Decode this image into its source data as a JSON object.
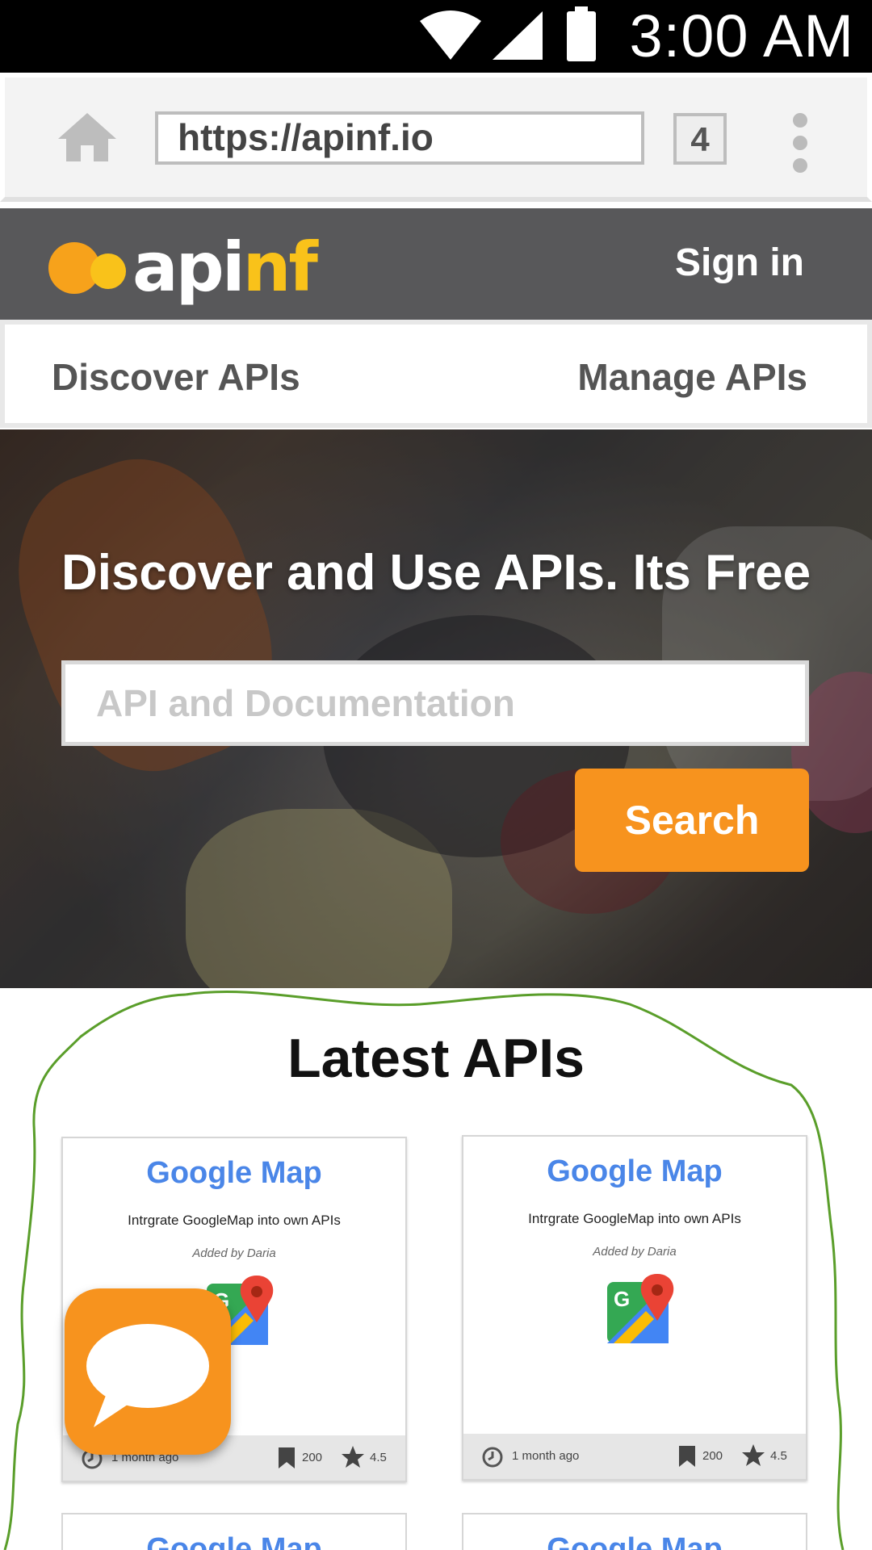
{
  "status_bar": {
    "time": "3:00 AM",
    "icons": [
      "wifi-icon",
      "cell-signal-icon",
      "battery-icon"
    ]
  },
  "browser": {
    "url": "https://apinf.io",
    "tab_count": "4",
    "icons": [
      "home-icon",
      "overflow-menu-icon"
    ]
  },
  "header": {
    "logo_text_main": "api",
    "logo_text_accent": "nf",
    "sign_in": "Sign in"
  },
  "nav": {
    "discover": "Discover APIs",
    "manage": "Manage APIs"
  },
  "hero": {
    "title": "Discover and Use APIs. Its Free",
    "search_placeholder": "API and Documentation",
    "search_button": "Search"
  },
  "latest": {
    "title": "Latest APIs",
    "cards": [
      {
        "name": "Google Map",
        "description": "Intrgrate GoogleMap into own APIs",
        "author": "Added by Daria",
        "age": "1 month ago",
        "bookmarks": "200",
        "rating": "4.5"
      },
      {
        "name": "Google Map",
        "description": "Intrgrate GoogleMap into own APIs",
        "author": "Added by Daria",
        "age": "1 month ago",
        "bookmarks": "200",
        "rating": "4.5"
      },
      {
        "name": "Google Map"
      },
      {
        "name": "Google Map"
      }
    ]
  },
  "colors": {
    "accent_orange": "#f7931e",
    "header_gray": "#58585a",
    "link_blue": "#4a86e8",
    "logo_yellow": "#f9c21a",
    "annotation_green": "#5a9e2a"
  }
}
